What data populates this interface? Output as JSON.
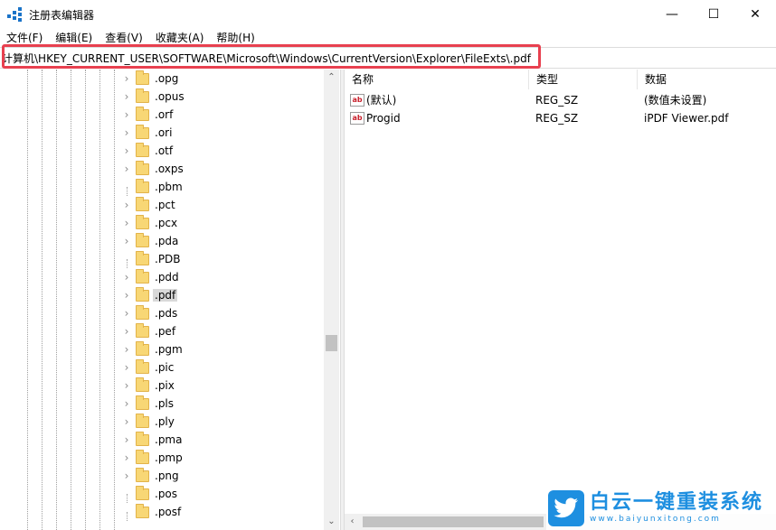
{
  "window": {
    "title": "注册表编辑器"
  },
  "window_controls": {
    "minimize": "—",
    "maximize": "☐",
    "close": "✕"
  },
  "menu": [
    "文件(F)",
    "编辑(E)",
    "查看(V)",
    "收藏夹(A)",
    "帮助(H)"
  ],
  "address": {
    "path": "计算机\\HKEY_CURRENT_USER\\SOFTWARE\\Microsoft\\Windows\\CurrentVersion\\Explorer\\FileExts\\.pdf",
    "highlight_color": "#e8404f"
  },
  "tree": {
    "items": [
      {
        "label": ".opg",
        "expandable": true,
        "selected": false
      },
      {
        "label": ".opus",
        "expandable": true,
        "selected": false
      },
      {
        "label": ".orf",
        "expandable": true,
        "selected": false
      },
      {
        "label": ".ori",
        "expandable": true,
        "selected": false
      },
      {
        "label": ".otf",
        "expandable": true,
        "selected": false
      },
      {
        "label": ".oxps",
        "expandable": true,
        "selected": false
      },
      {
        "label": ".pbm",
        "expandable": false,
        "selected": false
      },
      {
        "label": ".pct",
        "expandable": true,
        "selected": false
      },
      {
        "label": ".pcx",
        "expandable": true,
        "selected": false
      },
      {
        "label": ".pda",
        "expandable": true,
        "selected": false
      },
      {
        "label": ".PDB",
        "expandable": false,
        "selected": false
      },
      {
        "label": ".pdd",
        "expandable": true,
        "selected": false
      },
      {
        "label": ".pdf",
        "expandable": true,
        "selected": true
      },
      {
        "label": ".pds",
        "expandable": true,
        "selected": false
      },
      {
        "label": ".pef",
        "expandable": true,
        "selected": false
      },
      {
        "label": ".pgm",
        "expandable": true,
        "selected": false
      },
      {
        "label": ".pic",
        "expandable": true,
        "selected": false
      },
      {
        "label": ".pix",
        "expandable": true,
        "selected": false
      },
      {
        "label": ".pls",
        "expandable": true,
        "selected": false
      },
      {
        "label": ".ply",
        "expandable": true,
        "selected": false
      },
      {
        "label": ".pma",
        "expandable": true,
        "selected": false
      },
      {
        "label": ".pmp",
        "expandable": true,
        "selected": false
      },
      {
        "label": ".png",
        "expandable": true,
        "selected": false
      },
      {
        "label": ".pos",
        "expandable": false,
        "selected": false
      },
      {
        "label": ".posf",
        "expandable": false,
        "selected": false
      }
    ]
  },
  "list": {
    "columns": [
      "名称",
      "类型",
      "数据"
    ],
    "rows": [
      {
        "icon": "string-value-icon",
        "icon_text": "ab",
        "name": "(默认)",
        "type": "REG_SZ",
        "data": "(数值未设置)"
      },
      {
        "icon": "string-value-icon",
        "icon_text": "ab",
        "name": "Progid",
        "type": "REG_SZ",
        "data": "iPDF Viewer.pdf"
      }
    ]
  },
  "scroll": {
    "up": "⌃",
    "down": "⌄",
    "left": "‹",
    "right": "›"
  },
  "watermark": {
    "title": "白云一键重装系统",
    "url": "www.baiyunxitong.com",
    "color": "#1e8fe0"
  }
}
